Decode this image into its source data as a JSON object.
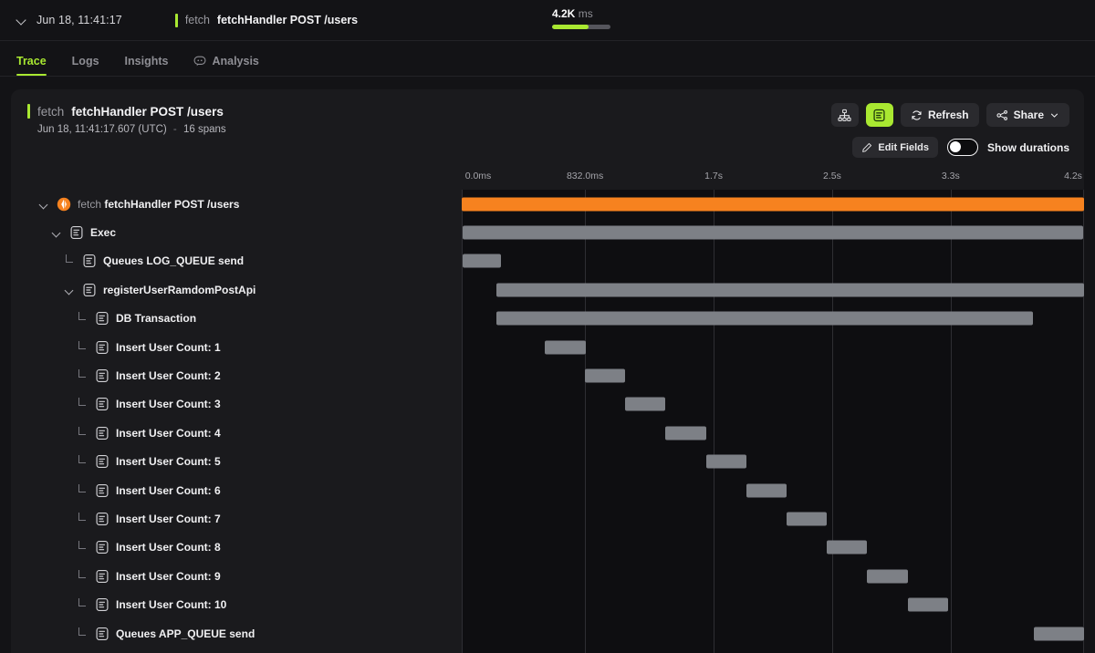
{
  "topbar": {
    "timestamp": "Jun 18, 11:41:17",
    "trace_prefix": "fetch",
    "trace_name": "fetchHandler POST /users",
    "duration_value": "4.2K",
    "duration_unit": "ms",
    "duration_fill_pct": 62,
    "chevron_icon": "chevron-down-icon"
  },
  "tabs": [
    {
      "label": "Trace",
      "active": true,
      "icon": ""
    },
    {
      "label": "Logs",
      "active": false,
      "icon": ""
    },
    {
      "label": "Insights",
      "active": false,
      "icon": ""
    },
    {
      "label": "Analysis",
      "active": false,
      "icon": "chat-bubble-icon"
    }
  ],
  "panel": {
    "title_prefix": "fetch",
    "title_name": "fetchHandler POST /users",
    "subtitle_time": "Jun 18, 11:41:17.607 (UTC)",
    "subtitle_sep": "-",
    "subtitle_spans": "16 spans",
    "buttons": {
      "tree_view_icon": "hierarchy-icon",
      "waterfall_view_icon": "waterfall-icon",
      "refresh_label": "Refresh",
      "refresh_icon": "refresh-icon",
      "share_label": "Share",
      "share_icon": "share-nodes-icon",
      "share_chevron_icon": "chevron-down-icon"
    },
    "edit_fields_label": "Edit Fields",
    "edit_fields_icon": "pencil-icon",
    "show_durations_label": "Show durations",
    "show_durations_on": false
  },
  "accent_colors": {
    "green": "#a9e831",
    "orange": "#f6821f",
    "bar_gray": "#7d8086",
    "panel_bg": "#1a1a1d",
    "page_bg": "#131316",
    "waterfall_bg": "#0e0e11"
  },
  "chart_data": {
    "type": "bar",
    "title": "Trace waterfall — fetchHandler POST /users",
    "xlabel": "",
    "ylabel": "",
    "xlim": [
      0,
      4200
    ],
    "axis_unit": "ms",
    "grid": true,
    "legend": "none",
    "tick_labels": [
      "0.0ms",
      "832.0ms",
      "1.7s",
      "2.5s",
      "3.3s",
      "4.2s"
    ],
    "tick_values": [
      0,
      832,
      1700,
      2500,
      3300,
      4200
    ],
    "categories": [
      "fetch fetchHandler POST /users",
      "Exec",
      "Queues LOG_QUEUE send",
      "registerUserRamdomPostApi",
      "DB Transaction",
      "Insert User Count: 1",
      "Insert User Count: 2",
      "Insert User Count: 3",
      "Insert User Count: 4",
      "Insert User Count: 5",
      "Insert User Count: 6",
      "Insert User Count: 7",
      "Insert User Count: 8",
      "Insert User Count: 9",
      "Insert User Count: 10",
      "Queues APP_QUEUE send"
    ],
    "spans": [
      {
        "label": "fetch fetchHandler POST /users",
        "prefix": "fetch",
        "name": "fetchHandler POST /users",
        "depth": 0,
        "icon": "cloudflare-logo-icon",
        "twisty": "chevron-down-icon",
        "color": "#f6821f",
        "start_ms": 0,
        "end_ms": 4200
      },
      {
        "label": "Exec",
        "prefix": "",
        "name": "Exec",
        "depth": 1,
        "icon": "span-log-icon",
        "twisty": "chevron-down-icon",
        "color": "#7d8086",
        "start_ms": 5,
        "end_ms": 4195
      },
      {
        "label": "Queues LOG_QUEUE send",
        "prefix": "",
        "name": "Queues LOG_QUEUE send",
        "depth": 2,
        "icon": "span-log-icon",
        "twisty": "elbow-icon",
        "color": "#7d8086",
        "start_ms": 5,
        "end_ms": 265
      },
      {
        "label": "registerUserRamdomPostApi",
        "prefix": "",
        "name": "registerUserRamdomPostApi",
        "depth": 2,
        "icon": "span-log-icon",
        "twisty": "chevron-down-icon",
        "color": "#7d8086",
        "start_ms": 237,
        "end_ms": 4200
      },
      {
        "label": "DB Transaction",
        "prefix": "",
        "name": "DB Transaction",
        "depth": 3,
        "icon": "span-log-icon",
        "twisty": "elbow-icon",
        "color": "#7d8086",
        "start_ms": 237,
        "end_ms": 3855
      },
      {
        "label": "Insert User Count: 1",
        "prefix": "",
        "name": "Insert User Count: 1",
        "depth": 3,
        "icon": "span-log-icon",
        "twisty": "elbow-icon",
        "color": "#7d8086",
        "start_ms": 560,
        "end_ms": 835
      },
      {
        "label": "Insert User Count: 2",
        "prefix": "",
        "name": "Insert User Count: 2",
        "depth": 3,
        "icon": "span-log-icon",
        "twisty": "elbow-icon",
        "color": "#7d8086",
        "start_ms": 832,
        "end_ms": 1105
      },
      {
        "label": "Insert User Count: 3",
        "prefix": "",
        "name": "Insert User Count: 3",
        "depth": 3,
        "icon": "span-log-icon",
        "twisty": "elbow-icon",
        "color": "#7d8086",
        "start_ms": 1104,
        "end_ms": 1375
      },
      {
        "label": "Insert User Count: 4",
        "prefix": "",
        "name": "Insert User Count: 4",
        "depth": 3,
        "icon": "span-log-icon",
        "twisty": "elbow-icon",
        "color": "#7d8086",
        "start_ms": 1375,
        "end_ms": 1648
      },
      {
        "label": "Insert User Count: 5",
        "prefix": "",
        "name": "Insert User Count: 5",
        "depth": 3,
        "icon": "span-log-icon",
        "twisty": "elbow-icon",
        "color": "#7d8086",
        "start_ms": 1648,
        "end_ms": 1920
      },
      {
        "label": "Insert User Count: 6",
        "prefix": "",
        "name": "Insert User Count: 6",
        "depth": 3,
        "icon": "span-log-icon",
        "twisty": "elbow-icon",
        "color": "#7d8086",
        "start_ms": 1920,
        "end_ms": 2192
      },
      {
        "label": "Insert User Count: 7",
        "prefix": "",
        "name": "Insert User Count: 7",
        "depth": 3,
        "icon": "span-log-icon",
        "twisty": "elbow-icon",
        "color": "#7d8086",
        "start_ms": 2192,
        "end_ms": 2465
      },
      {
        "label": "Insert User Count: 8",
        "prefix": "",
        "name": "Insert User Count: 8",
        "depth": 3,
        "icon": "span-log-icon",
        "twisty": "elbow-icon",
        "color": "#7d8086",
        "start_ms": 2465,
        "end_ms": 2737
      },
      {
        "label": "Insert User Count: 9",
        "prefix": "",
        "name": "Insert User Count: 9",
        "depth": 3,
        "icon": "span-log-icon",
        "twisty": "elbow-icon",
        "color": "#7d8086",
        "start_ms": 2737,
        "end_ms": 3010
      },
      {
        "label": "Insert User Count: 10",
        "prefix": "",
        "name": "Insert User Count: 10",
        "depth": 3,
        "icon": "span-log-icon",
        "twisty": "elbow-icon",
        "color": "#7d8086",
        "start_ms": 3010,
        "end_ms": 3282
      },
      {
        "label": "Queues APP_QUEUE send",
        "prefix": "",
        "name": "Queues APP_QUEUE send",
        "depth": 3,
        "icon": "span-log-icon",
        "twisty": "elbow-icon",
        "color": "#7d8086",
        "start_ms": 3860,
        "end_ms": 4200
      }
    ]
  }
}
